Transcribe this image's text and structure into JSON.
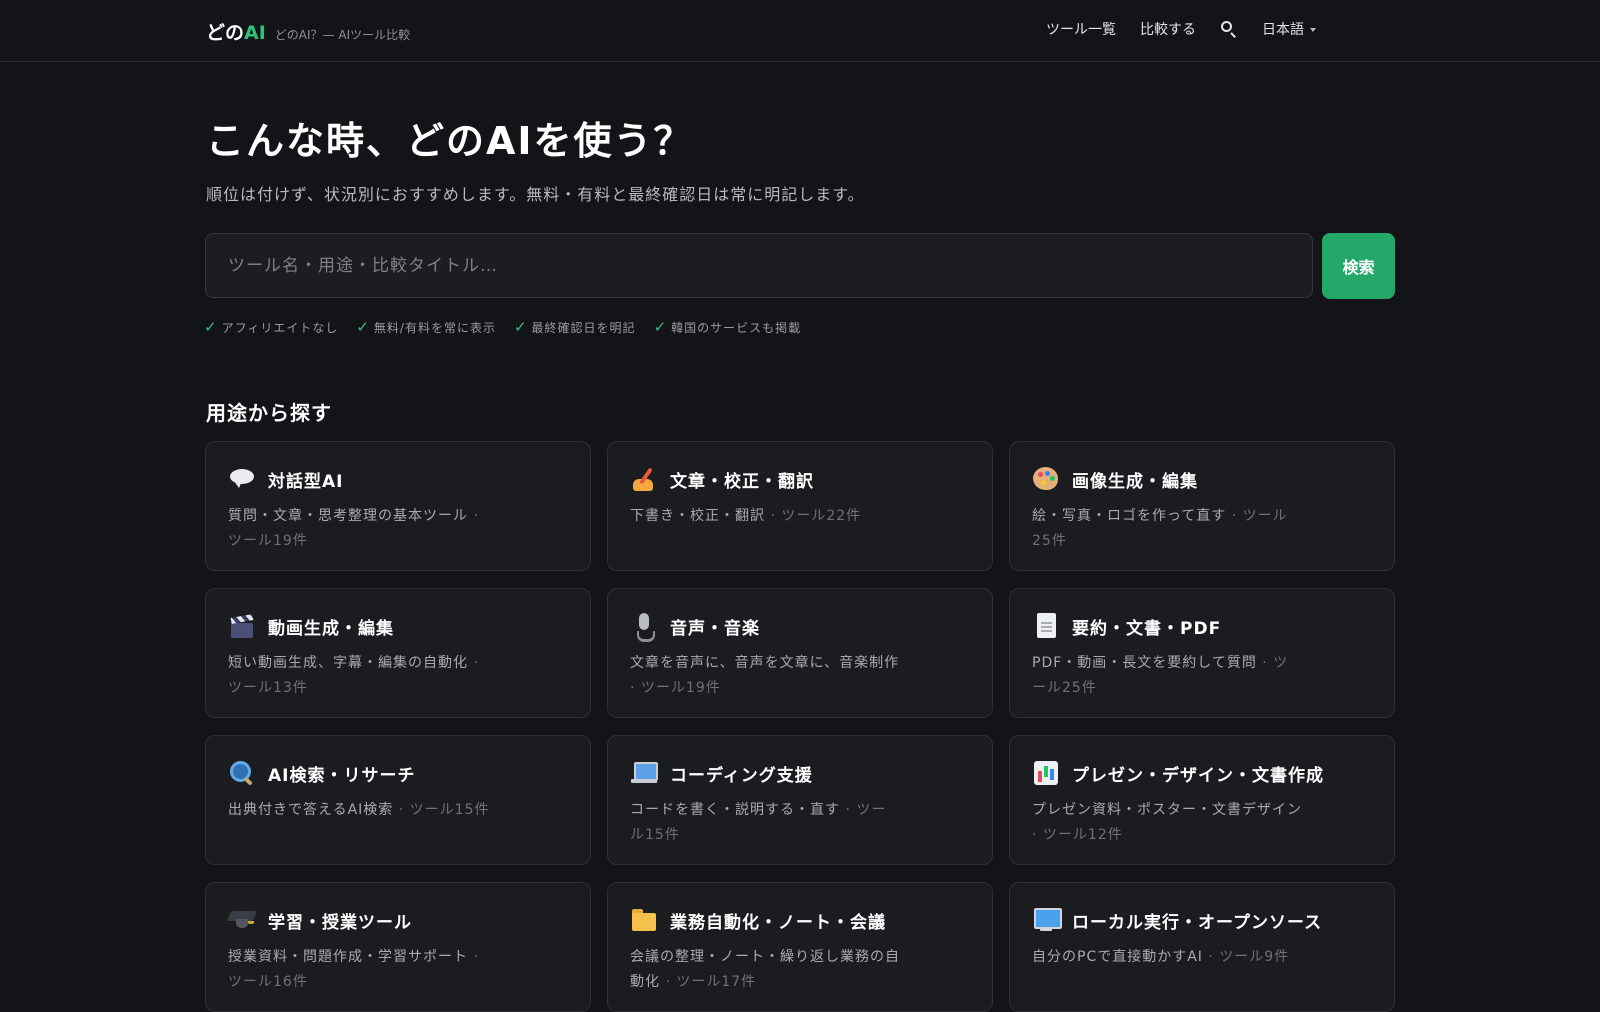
{
  "header": {
    "logo_main": "どの",
    "logo_accent": "AI",
    "tagline": "どのAI？— AIツール比較",
    "nav": {
      "tools": "ツール一覧",
      "compare": "比較する",
      "search_icon": "search-icon",
      "language": "日本語"
    }
  },
  "hero": {
    "title": "こんな時、どのAIを使う？",
    "subtitle": "順位は付けず、状況別におすすめします。無料・有料と最終確認日は常に明記します。",
    "search_placeholder": "ツール名・用途・比較タイトル…",
    "search_button": "検索"
  },
  "badges": [
    "アフィリエイトなし",
    "無料/有料を常に表示",
    "最終確認日を明記",
    "韓国のサービスも掲載"
  ],
  "section_title": "用途から探す",
  "categories": [
    {
      "icon": "speech-bubble-icon",
      "title": "対話型AI",
      "desc": "質問・文章・思考整理の基本ツール",
      "count": "ツール19件"
    },
    {
      "icon": "writing-hand-icon",
      "title": "文章・校正・翻訳",
      "desc": "下書き・校正・翻訳",
      "count": "ツール22件"
    },
    {
      "icon": "palette-icon",
      "title": "画像生成・編集",
      "desc": "絵・写真・ロゴを作って直す",
      "count": "ツール25件"
    },
    {
      "icon": "clapper-board-icon",
      "title": "動画生成・編集",
      "desc": "短い動画生成、字幕・編集の自動化",
      "count": "ツール13件"
    },
    {
      "icon": "microphone-icon",
      "title": "音声・音楽",
      "desc": "文章を音声に、音声を文章に、音楽制作",
      "count": "ツール19件"
    },
    {
      "icon": "document-icon",
      "title": "要約・文書・PDF",
      "desc": "PDF・動画・長文を要約して質問",
      "count": "ツール25件"
    },
    {
      "icon": "magnifier-icon",
      "title": "AI検索・リサーチ",
      "desc": "出典付きで答えるAI検索",
      "count": "ツール15件"
    },
    {
      "icon": "laptop-icon",
      "title": "コーディング支援",
      "desc": "コードを書く・説明する・直す",
      "count": "ツール15件"
    },
    {
      "icon": "bar-chart-icon",
      "title": "プレゼン・デザイン・文書作成",
      "desc": "プレゼン資料・ポスター・文書デザイン",
      "count": "ツール12件"
    },
    {
      "icon": "graduation-cap-icon",
      "title": "学習・授業ツール",
      "desc": "授業資料・問題作成・学習サポート",
      "count": "ツール16件"
    },
    {
      "icon": "folder-icon",
      "title": "業務自動化・ノート・会議",
      "desc": "会議の整理・ノート・繰り返し業務の自動化",
      "count": "ツール17件"
    },
    {
      "icon": "desktop-computer-icon",
      "title": "ローカル実行・オープンソース",
      "desc": "自分のPCで直接動かすAI",
      "count": "ツール9件"
    }
  ]
}
